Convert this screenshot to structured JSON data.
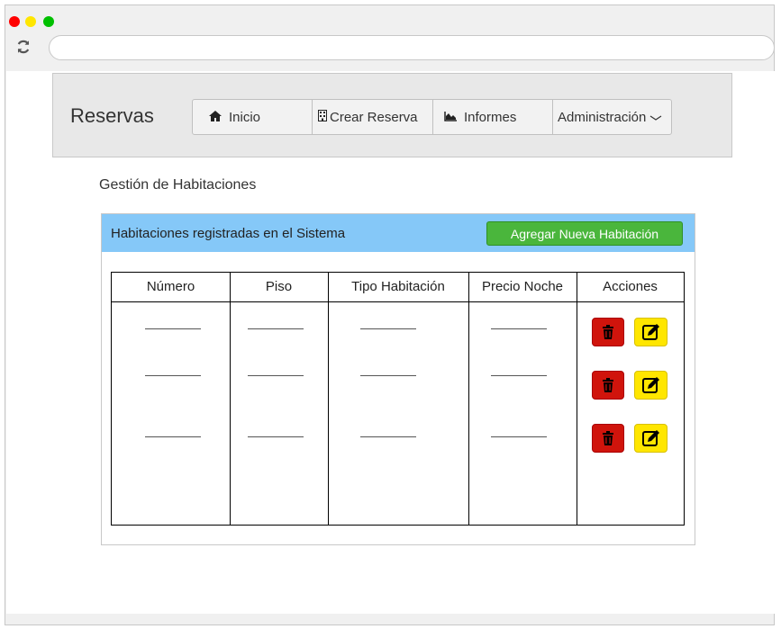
{
  "browser": {
    "traffic_lights": [
      "#ff0000",
      "#ffe600",
      "#00c000"
    ],
    "reload_icon": "reload-icon"
  },
  "navbar": {
    "brand": "Reservas",
    "items": [
      {
        "label": "Inicio",
        "icon": "home-icon"
      },
      {
        "label": "Crear Reserva",
        "icon": "building-icon"
      },
      {
        "label": "Informes",
        "icon": "area-chart-icon"
      },
      {
        "label": "Administración",
        "icon": "chevron-down-icon"
      }
    ]
  },
  "page": {
    "title": "Gestión de Habitaciones"
  },
  "panel": {
    "title": "Habitaciones registradas en el Sistema",
    "add_button": "Agregar Nueva Habitación",
    "header_color": "#85c8f8",
    "add_color": "#4ab63c"
  },
  "table": {
    "columns": [
      "Número",
      "Piso",
      "Tipo Habitación",
      "Precio Noche",
      "Acciones"
    ],
    "rows": [
      {
        "numero": "",
        "piso": "",
        "tipo": "",
        "precio": "",
        "actions": [
          "delete-icon",
          "edit-icon"
        ]
      },
      {
        "numero": "",
        "piso": "",
        "tipo": "",
        "precio": "",
        "actions": [
          "delete-icon",
          "edit-icon"
        ]
      },
      {
        "numero": "",
        "piso": "",
        "tipo": "",
        "precio": "",
        "actions": [
          "delete-icon",
          "edit-icon"
        ]
      }
    ],
    "delete_color": "#d0140c",
    "edit_color": "#ffe600"
  }
}
